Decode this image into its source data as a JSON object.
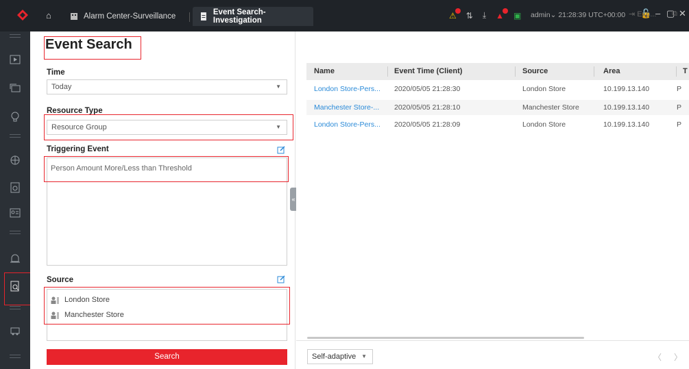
{
  "titlebar": {
    "tabs": [
      {
        "label": "Alarm Center-Surveillance"
      },
      {
        "label": "Event Search-Investigation"
      }
    ],
    "user": "admin",
    "clock": "21:28:39 UTC+00:00",
    "badges": {
      "alarm": "1",
      "notify": "3"
    }
  },
  "form": {
    "title": "Event Search",
    "time_label": "Time",
    "time_value": "Today",
    "resource_type_label": "Resource Type",
    "resource_type_value": "Resource Group",
    "triggering_event_label": "Triggering Event",
    "triggering_event_value": "Person Amount More/Less than Threshold",
    "source_label": "Source",
    "sources": [
      "London Store",
      "Manchester Store"
    ],
    "search_label": "Search"
  },
  "results": {
    "export_label": "Exp...",
    "columns": [
      "Name",
      "Event Time (Client)",
      "Source",
      "Area",
      "T"
    ],
    "rows": [
      {
        "name": "London Store-Pers...",
        "time": "2020/05/05 21:28:30",
        "source": "London Store",
        "area": "10.199.13.140",
        "t": "P"
      },
      {
        "name": "Manchester Store-...",
        "time": "2020/05/05 21:28:10",
        "source": "Manchester Store",
        "area": "10.199.13.140",
        "t": "P"
      },
      {
        "name": "London Store-Pers...",
        "time": "2020/05/05 21:28:09",
        "source": "London Store",
        "area": "10.199.13.140",
        "t": "P"
      }
    ],
    "page_size_value": "Self-adaptive"
  },
  "colors": {
    "accent": "#e8242c",
    "link": "#2a8ad8",
    "titlebar": "#1f2328",
    "sidebar": "#2b3036"
  }
}
